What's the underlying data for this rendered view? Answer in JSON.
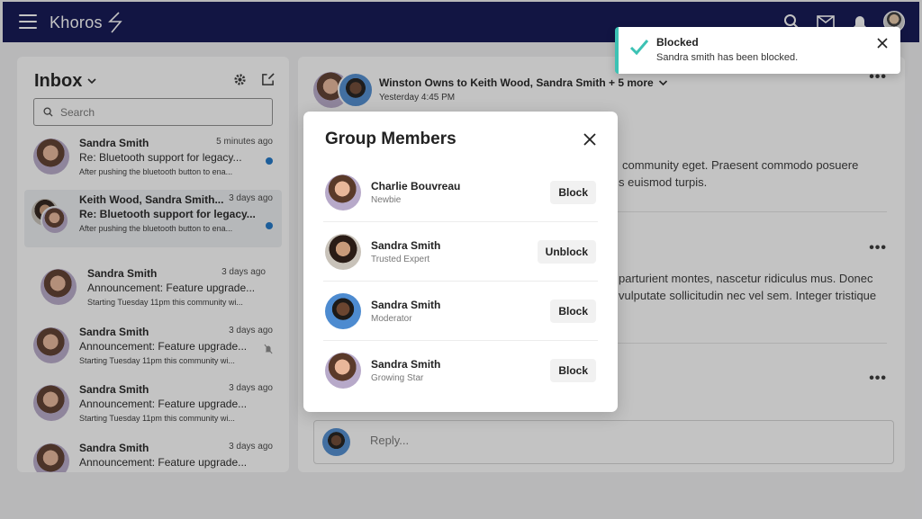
{
  "topbar": {
    "logo": "Khoros",
    "icons": [
      "menu-icon",
      "search-icon",
      "mail-icon",
      "bell-icon",
      "user-avatar"
    ]
  },
  "inbox": {
    "title": "Inbox",
    "search_placeholder": "Search",
    "messages": [
      {
        "name": "Sandra Smith",
        "time": "5 minutes ago",
        "subject": "Re: Bluetooth support for legacy...",
        "preview": "After pushing the bluetooth button to ena...",
        "unread": true
      },
      {
        "name": "Keith Wood, Sandra Smith...",
        "time": "3 days ago",
        "subject": "Re: Bluetooth support for legacy...",
        "preview": "After pushing the bluetooth button to ena...",
        "unread": true
      },
      {
        "name": "Sandra Smith",
        "time": "3 days ago",
        "subject": "Announcement: Feature upgrade...",
        "preview": "Starting Tuesday 11pm this community wi..."
      },
      {
        "name": "Sandra Smith",
        "time": "3 days ago",
        "subject": "Announcement: Feature upgrade...",
        "preview": "Starting Tuesday 11pm this community wi...",
        "muted": true
      },
      {
        "name": "Sandra Smith",
        "time": "3 days ago",
        "subject": "Announcement: Feature upgrade...",
        "preview": "Starting Tuesday 11pm this community wi..."
      },
      {
        "name": "Sandra Smith",
        "time": "3 days ago",
        "subject": "Announcement: Feature upgrade..."
      }
    ]
  },
  "conversation": {
    "title": "Winston Owns to Keith Wood, Sandra Smith + 5 more",
    "time": "Yesterday 4:45 PM",
    "text_1a": "community eget. Praesent commodo posuere",
    "text_1b": "s euismod turpis.",
    "text_2a": "parturient montes, nascetur ridiculus mus. Donec",
    "text_2b": "vulputate sollicitudin nec vel sem. Integer tristique",
    "more": "•••",
    "reply_placeholder": "Reply..."
  },
  "modal": {
    "title": "Group Members",
    "members": [
      {
        "name": "Charlie Bouvreau",
        "role": "Newbie",
        "action": "Block"
      },
      {
        "name": "Sandra Smith",
        "role": "Trusted Expert",
        "action": "Unblock"
      },
      {
        "name": "Sandra Smith",
        "role": "Moderator",
        "action": "Block"
      },
      {
        "name": "Sandra Smith",
        "role": "Growing Star",
        "action": "Block"
      }
    ]
  },
  "toast": {
    "title": "Blocked",
    "message": "Sandra smith has been blocked.",
    "accent": "#3cc2b4"
  },
  "colors": {
    "topbar": "#0b0f4e",
    "unread_dot": "#1a73c7"
  }
}
